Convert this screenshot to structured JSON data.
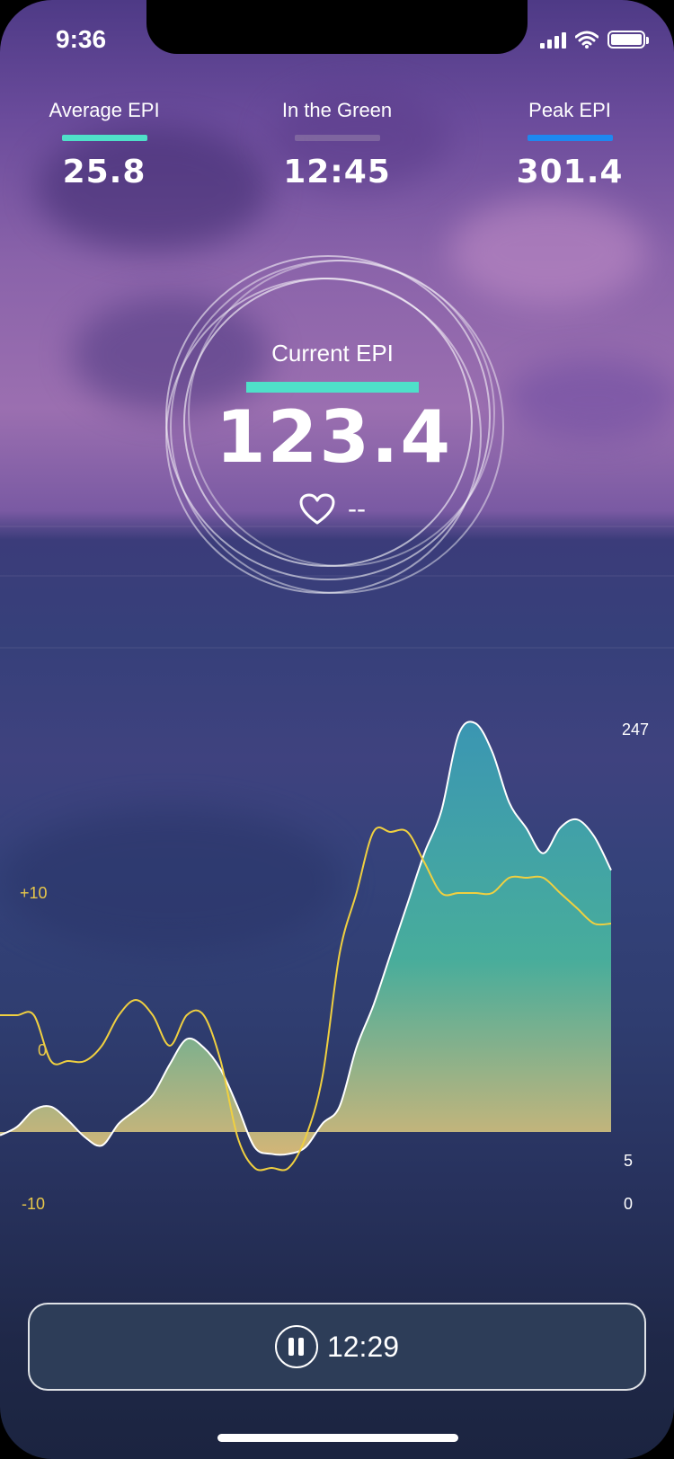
{
  "status_bar": {
    "time": "9:36"
  },
  "stats": [
    {
      "label": "Average EPI",
      "value": "25.8",
      "color": "#4fe0c9"
    },
    {
      "label": "In the Green",
      "value": "12:45",
      "color": "#8a78a8"
    },
    {
      "label": "Peak EPI",
      "value": "301.4",
      "color": "#1e88f0"
    }
  ],
  "current": {
    "label": "Current EPI",
    "value": "123.4",
    "heart_rate": "--"
  },
  "chart_data": {
    "type": "area",
    "right_axis_ticks": [
      "247",
      "5",
      "0"
    ],
    "left_axis_ticks": [
      "+10",
      "0",
      "-10"
    ],
    "epi_series": [
      3,
      8,
      18,
      20,
      12,
      2,
      -3,
      10,
      18,
      27,
      45,
      60,
      55,
      42,
      20,
      -4,
      -8,
      -8,
      -4,
      10,
      20,
      55,
      80,
      110,
      140,
      170,
      195,
      240,
      247,
      230,
      200,
      185,
      170,
      185,
      190,
      180,
      160
    ],
    "secondary_series": [
      0,
      0,
      0,
      -3,
      -3,
      -3,
      -2,
      0,
      1,
      0,
      -2,
      0,
      0,
      -3,
      -8,
      -10,
      -10,
      -10,
      -8,
      -4,
      4,
      8,
      12,
      12,
      12,
      10,
      8,
      8,
      8,
      8,
      9,
      9,
      9,
      8,
      7,
      6,
      6
    ],
    "area_color_top": "#3aa8b8",
    "area_color_bottom": "#e0c27a",
    "line_color": "#f0d040"
  },
  "timer": {
    "value": "12:29"
  }
}
